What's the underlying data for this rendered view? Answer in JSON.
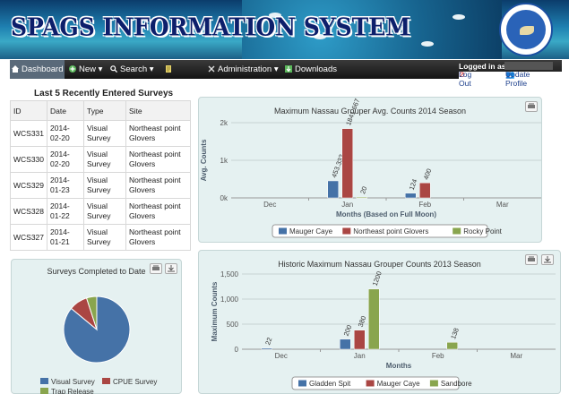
{
  "app": {
    "title": "SPAGS INFORMATION SYSTEM",
    "seal_text": "Belize Spawning Aggregation Working Group"
  },
  "nav": {
    "items": [
      {
        "label": "Dashboard",
        "icon": "home-icon"
      },
      {
        "label": "New",
        "icon": "plus-circle-icon"
      },
      {
        "label": "Search",
        "icon": "search-icon"
      },
      {
        "label": "Reports",
        "icon": "report-icon"
      },
      {
        "label": "Administration",
        "icon": "tools-icon"
      },
      {
        "label": "Downloads",
        "icon": "download-icon"
      }
    ]
  },
  "user": {
    "logged_in_label": "Logged in as",
    "logout": "Log Out",
    "update_profile": "Update Profile"
  },
  "recent": {
    "title": "Last 5 Recently Entered Surveys",
    "headers": [
      "ID",
      "Date",
      "Type",
      "Site"
    ],
    "rows": [
      [
        "WCS331",
        "2014-02-20",
        "Visual Survey",
        "Northeast point Glovers"
      ],
      [
        "WCS330",
        "2014-02-20",
        "Visual Survey",
        "Northeast point Glovers"
      ],
      [
        "WCS329",
        "2014-01-23",
        "Visual Survey",
        "Northeast point Glovers"
      ],
      [
        "WCS328",
        "2014-01-22",
        "Visual Survey",
        "Northeast point Glovers"
      ],
      [
        "WCS327",
        "2014-01-21",
        "Visual Survey",
        "Northeast point Glovers"
      ]
    ]
  },
  "colors": {
    "blue": "#4572a7",
    "red": "#aa4643",
    "green": "#89a54e"
  },
  "chart_data": [
    {
      "type": "bar",
      "title": "Maximum Nassau Grouper Avg. Counts 2014 Season",
      "xlabel": "Months (Based on Full Moon)",
      "ylabel": "Avg. Counts",
      "categories": [
        "Dec",
        "Jan",
        "Feb",
        "Mar"
      ],
      "series": [
        {
          "name": "Mauger Caye",
          "values": [
            null,
            453.333,
            124,
            null
          ],
          "labels": [
            "",
            "453.333",
            "124",
            ""
          ]
        },
        {
          "name": "Northeast point Glovers",
          "values": [
            null,
            1841.667,
            400,
            null
          ],
          "labels": [
            "",
            "1841.667",
            "400",
            ""
          ]
        },
        {
          "name": "Rocky Point",
          "values": [
            null,
            20,
            null,
            null
          ],
          "labels": [
            "",
            "20",
            "",
            ""
          ]
        }
      ],
      "ylim": [
        0,
        2000
      ],
      "yticks": [
        0,
        1000,
        2000
      ],
      "ytick_labels": [
        "0k",
        "1k",
        "2k"
      ]
    },
    {
      "type": "pie",
      "title": "Surveys Completed to Date",
      "slices": [
        {
          "name": "Visual Survey",
          "value": 86
        },
        {
          "name": "CPUE Survey",
          "value": 9
        },
        {
          "name": "Trap Release",
          "value": 5
        }
      ]
    },
    {
      "type": "bar",
      "title": "Historic Maximum Nassau Grouper Counts 2013 Season",
      "xlabel": "Months",
      "ylabel": "Maximum Counts",
      "categories": [
        "Dec",
        "Jan",
        "Feb",
        "Mar"
      ],
      "series": [
        {
          "name": "Gladden Spit",
          "values": [
            22,
            200,
            null,
            null
          ],
          "labels": [
            "22",
            "200",
            "",
            ""
          ]
        },
        {
          "name": "Mauger Caye",
          "values": [
            null,
            380,
            null,
            null
          ],
          "labels": [
            "",
            "380",
            "",
            ""
          ]
        },
        {
          "name": "Sandbore",
          "values": [
            null,
            1200,
            138,
            null
          ],
          "labels": [
            "",
            "1200",
            "138",
            ""
          ]
        }
      ],
      "ylim": [
        0,
        1500
      ],
      "yticks": [
        0,
        500,
        1000,
        1500
      ],
      "ytick_labels": [
        "0",
        "500",
        "1,000",
        "1,500"
      ]
    }
  ]
}
